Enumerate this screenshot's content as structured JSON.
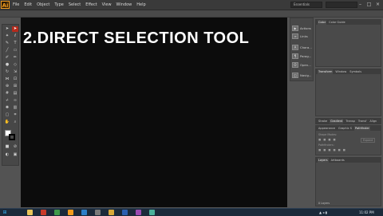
{
  "app": {
    "logo": "Ai"
  },
  "menu": [
    "File",
    "Edit",
    "Object",
    "Type",
    "Select",
    "Effect",
    "View",
    "Window",
    "Help"
  ],
  "workspace": "Essentials",
  "window_controls": [
    "–",
    "□",
    "×"
  ],
  "canvas": {
    "headline": "2.DIRECT SELECTION TOOL"
  },
  "dock": [
    {
      "icon": "actions-icon",
      "label": "Actions"
    },
    {
      "icon": "links-icon",
      "label": "Links"
    },
    {
      "icon": "character-icon",
      "label": "Chara..."
    },
    {
      "icon": "paragraph-icon",
      "label": "Parag..."
    },
    {
      "icon": "opentype-icon",
      "label": "Open..."
    },
    {
      "icon": "navigator-icon",
      "label": "Navig..."
    }
  ],
  "panels": {
    "color": {
      "tabs": [
        "Color",
        "Color Guide"
      ]
    },
    "transform": {
      "tabs": [
        "Transform",
        "Window",
        "Symbols"
      ]
    },
    "stroke": {
      "tabs": [
        "Stroke",
        "Gradient",
        "Transp",
        "Transf",
        "Align"
      ]
    },
    "appearance": {
      "tabs": [
        "Appearance",
        "Graphic S",
        "Pathfinder"
      ]
    },
    "pathfinder": {
      "shape_modes": "Shape Modes:",
      "pathfinders": "Pathfinders:",
      "expand": "Expand"
    },
    "layers": {
      "tabs": [
        "Layers",
        "Artboards"
      ],
      "footer": "0 Layers"
    }
  },
  "taskbar": {
    "time": "11:02 PM",
    "apps": [
      {
        "name": "explorer",
        "color": "#e8c45a"
      },
      {
        "name": "media",
        "color": "#c83a2a"
      },
      {
        "name": "chrome",
        "color": "#3f9a4a"
      },
      {
        "name": "illustrator",
        "color": "#f39c1e"
      },
      {
        "name": "photoshop",
        "color": "#2c7fc8"
      },
      {
        "name": "recorder",
        "color": "#7a7a7a"
      },
      {
        "name": "folder",
        "color": "#d8a838"
      },
      {
        "name": "word",
        "color": "#2b5fb0"
      },
      {
        "name": "app",
        "color": "#9a4ab0"
      },
      {
        "name": "app2",
        "color": "#4ab09a"
      }
    ]
  }
}
